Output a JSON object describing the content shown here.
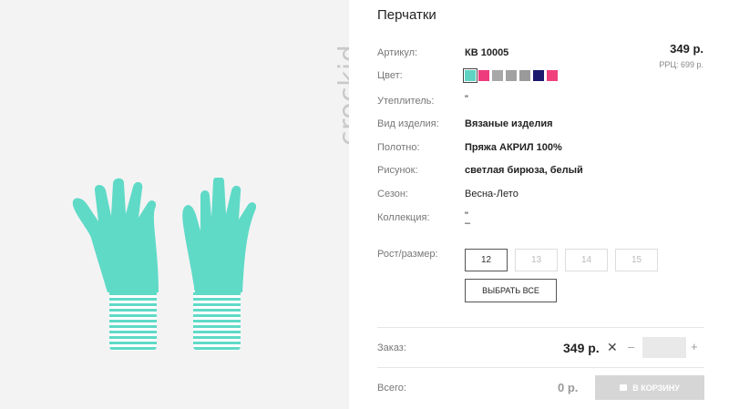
{
  "image": {
    "brand": "crockid"
  },
  "product": {
    "title": "Перчатки",
    "price": "349 р.",
    "rrp": "РРЦ: 699 р."
  },
  "specs": {
    "article_label": "Артикул:",
    "article_value": "КВ 10005",
    "color_label": "Цвет:",
    "insulation_label": "Утеплитель:",
    "insulation_value": "\"",
    "type_label": "Вид изделия:",
    "type_value": "Вязаные изделия",
    "fabric_label": "Полотно:",
    "fabric_value": "Пряжа АКРИЛ 100%",
    "pattern_label": "Рисунок:",
    "pattern_value": "светлая бирюза, белый",
    "season_label": "Сезон:",
    "season_value": "Весна-Лето",
    "collection_label": "Коллекция:",
    "collection_value_1": "\"",
    "collection_value_2": "–"
  },
  "colors": [
    {
      "hex": "#5fd3c3",
      "active": true
    },
    {
      "hex": "#ee3b7d",
      "active": false
    },
    {
      "hex": "#a7a7a7",
      "active": false
    },
    {
      "hex": "#a1a1a1",
      "active": false
    },
    {
      "hex": "#9a9a9a",
      "active": false
    },
    {
      "hex": "#1c1a6e",
      "active": false
    },
    {
      "hex": "#f0417c",
      "active": false
    }
  ],
  "sizes": {
    "label": "Рост/размер:",
    "options": [
      {
        "label": "12",
        "selected": true
      },
      {
        "label": "13",
        "selected": false
      },
      {
        "label": "14",
        "selected": false
      },
      {
        "label": "15",
        "selected": false
      }
    ],
    "select_all": "ВЫБРАТЬ ВСЕ"
  },
  "order": {
    "label": "Заказ:",
    "price": "349 р.",
    "times": "✕",
    "minus": "–",
    "plus": "+",
    "quantity": ""
  },
  "total": {
    "label": "Всего:",
    "value": "0 р.",
    "cart_button": "В КОРЗИНУ"
  },
  "theme": {
    "glove": "#5fdac7",
    "cuff_stripe": "#ffffff",
    "button_disabled": "#d6d6d6"
  }
}
